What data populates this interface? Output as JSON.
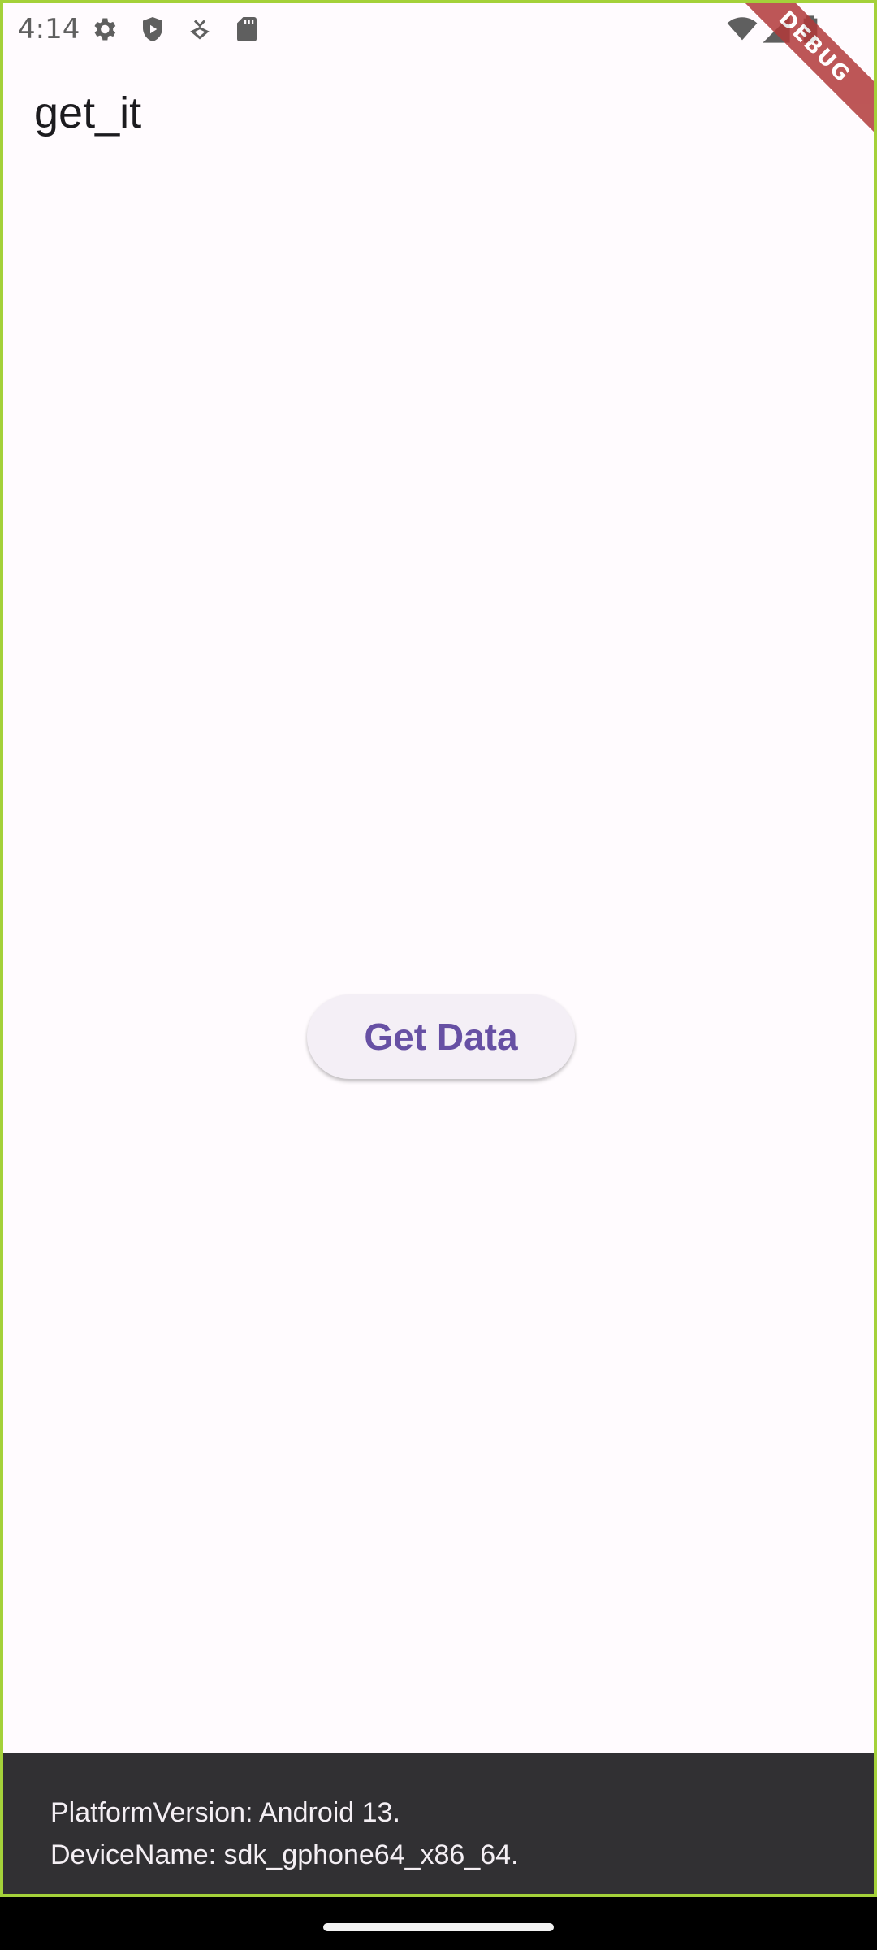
{
  "status_bar": {
    "time": "4:14",
    "left_icons": [
      "gear-icon",
      "shield-play-icon",
      "download-badge-icon",
      "sd-card-icon"
    ],
    "right_icons": [
      "wifi-icon",
      "signal-icon",
      "battery-icon"
    ]
  },
  "debug_banner": {
    "label": "DEBUG",
    "color": "#b23a3a"
  },
  "app_bar": {
    "title": "get_it"
  },
  "main": {
    "button_label": "Get Data",
    "button_text_color": "#6750a4",
    "button_background": "#f4eff6"
  },
  "snackbar": {
    "line1": "PlatformVersion: Android 13.",
    "line2": "DeviceName: sdk_gphone64_x86_64.",
    "background": "#313033"
  },
  "colors": {
    "page_background": "#fffbfe",
    "frame_border": "#a4d13a"
  }
}
